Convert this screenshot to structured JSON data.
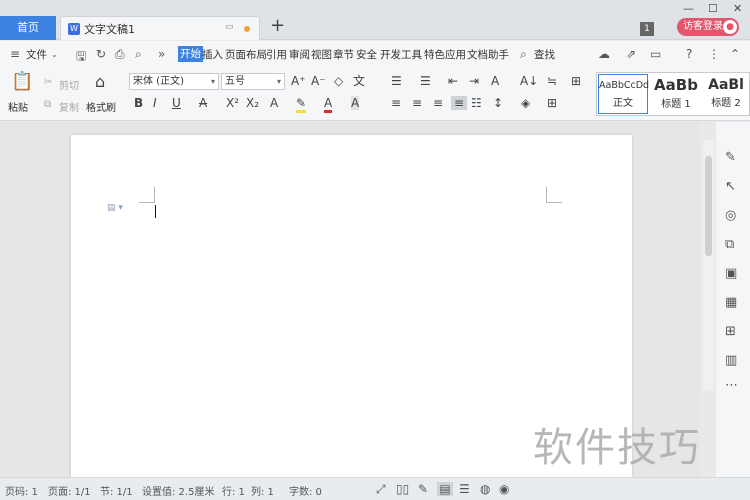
{
  "tabs": {
    "home": "首页",
    "doc": "文字文稿1",
    "new": "+"
  },
  "header": {
    "badge": "1",
    "login": "访客登录"
  },
  "menu": {
    "file": "文件",
    "items": [
      "开始",
      "插入",
      "页面布局",
      "引用",
      "审阅",
      "视图",
      "章节",
      "安全",
      "开发工具",
      "特色应用",
      "文档助手"
    ],
    "search": "查找",
    "help": "?"
  },
  "ribbon": {
    "paste": "粘贴",
    "cut": "剪切",
    "copy": "复制",
    "format_painter": "格式刷",
    "font_name": "宋体 (正文)",
    "font_size": "五号",
    "styles": [
      {
        "preview": "AaBbCcDd",
        "label": "正文"
      },
      {
        "preview": "AaBb",
        "label": "标题 1"
      },
      {
        "preview": "AaBl",
        "label": "标题 2"
      }
    ]
  },
  "status": {
    "page_num": "页码: 1",
    "pages": "页面: 1/1",
    "section": "节: 1/1",
    "setting": "设置值: 2.5厘米",
    "row": "行: 1",
    "col": "列: 1",
    "words": "字数: 0"
  },
  "watermark": "软件技巧",
  "colors": {
    "accent": "#3d82e0",
    "login": "#e2556a"
  }
}
